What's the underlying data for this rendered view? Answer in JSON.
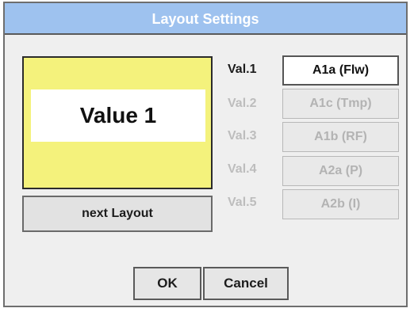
{
  "dialog": {
    "title": "Layout Settings"
  },
  "preview": {
    "value_text": "Value 1"
  },
  "buttons": {
    "next_layout": "next Layout",
    "ok": "OK",
    "cancel": "Cancel"
  },
  "values": [
    {
      "label": "Val.1",
      "channel": "A1a (Flw)",
      "active": true
    },
    {
      "label": "Val.2",
      "channel": "A1c (Tmp)",
      "active": false
    },
    {
      "label": "Val.3",
      "channel": "A1b (RF)",
      "active": false
    },
    {
      "label": "Val.4",
      "channel": "A2a (P)",
      "active": false
    },
    {
      "label": "Val.5",
      "channel": "A2b (I)",
      "active": false
    }
  ],
  "colors": {
    "title_bar": "#9ec2ef",
    "preview_background": "#f4f27c"
  }
}
